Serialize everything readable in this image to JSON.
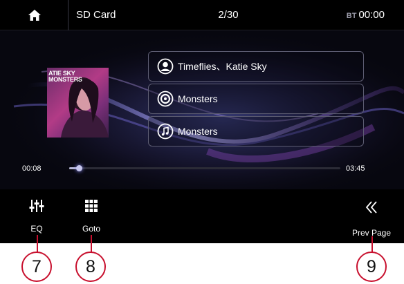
{
  "header": {
    "source": "SD Card",
    "track_counter": "2/30",
    "bt_label": "BT",
    "clock": "00:00"
  },
  "album": {
    "art_title_line1": "ATIE SKY",
    "art_title_line2": "MONSTERS"
  },
  "track_info": {
    "artist": "Timeflies、Katie Sky",
    "album": "Monsters",
    "title": "Monsters"
  },
  "playback": {
    "elapsed": "00:08",
    "total": "03:45",
    "progress_fraction": 0.036
  },
  "bottom_bar": {
    "eq_label": "EQ",
    "goto_label": "Goto",
    "prev_page_label": "Prev Page"
  },
  "callouts": [
    "7",
    "8",
    "9"
  ],
  "icons": {
    "home": "home-icon",
    "artist": "person-icon",
    "album": "disc-icon",
    "title": "music-note-icon",
    "eq": "equalizer-icon",
    "goto": "keypad-icon",
    "prev": "double-chevron-left-icon"
  },
  "colors": {
    "callout": "#c8102e",
    "background": "#07070f",
    "accent": "#8f8fff"
  }
}
